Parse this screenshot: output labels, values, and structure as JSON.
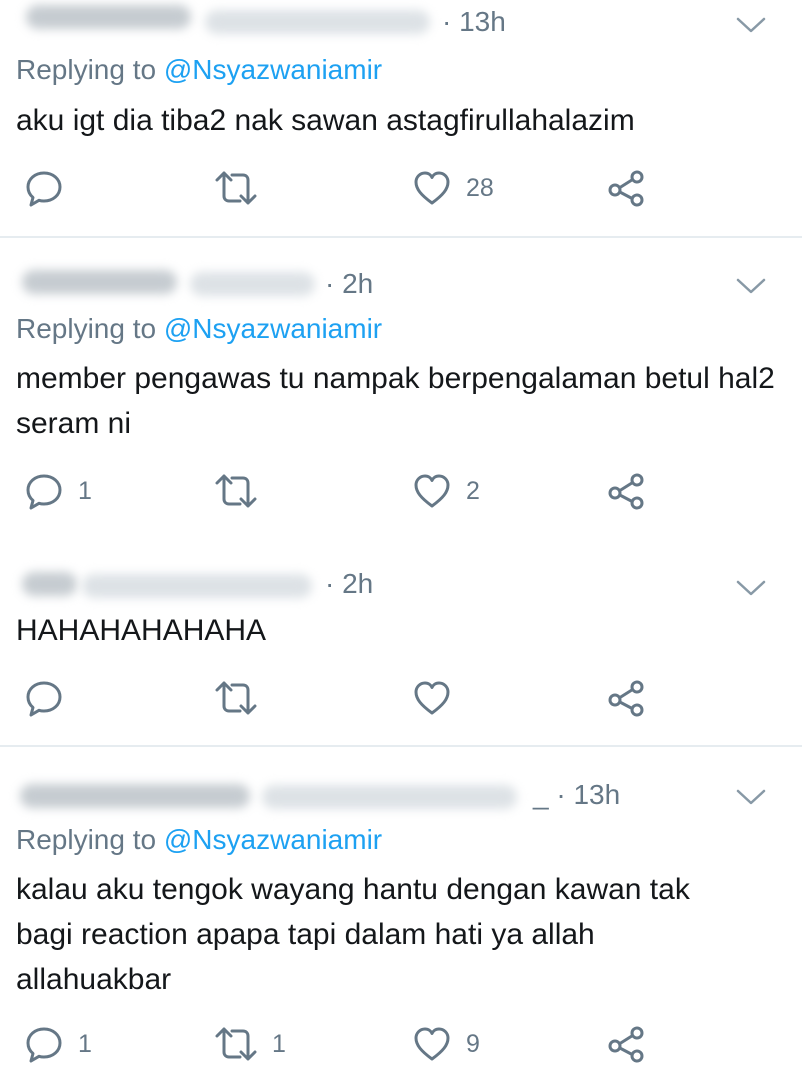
{
  "colors": {
    "text": "#14171a",
    "muted": "#657786",
    "link": "#1da1f2",
    "divider": "#e6ecf0",
    "icon": "#657786"
  },
  "icons": {
    "reply": "speech-bubble-icon",
    "retweet": "retweet-icon",
    "like": "heart-icon",
    "share": "share-nodes-icon",
    "menu": "chevron-down-icon"
  },
  "tweets": [
    {
      "time": "· 13h",
      "replying_prefix": "Replying to ",
      "replying_handle": "@Nsyazwaniamir",
      "text": "aku igt dia tiba2 nak sawan astagfirullahalazim",
      "replies": "",
      "retweets": "",
      "likes": "28"
    },
    {
      "time": "· 2h",
      "replying_prefix": "Replying to ",
      "replying_handle": "@Nsyazwaniamir",
      "text": "member pengawas tu nampak berpengalaman betul hal2 seram ni",
      "replies": "1",
      "retweets": "",
      "likes": "2"
    },
    {
      "time": "· 2h",
      "text": "HAHAHAHAHAHA",
      "replies": "",
      "retweets": "",
      "likes": ""
    },
    {
      "time": "_ · 13h",
      "replying_prefix": "Replying to ",
      "replying_handle": "@Nsyazwaniamir",
      "text": "kalau aku tengok wayang hantu dengan kawan tak bagi reaction apapa tapi dalam hati ya allah allahuakbar",
      "replies": "1",
      "retweets": "1",
      "likes": "9"
    }
  ]
}
